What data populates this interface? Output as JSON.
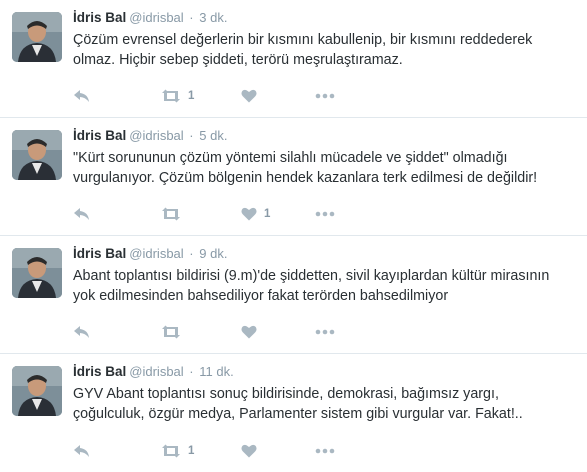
{
  "colors": {
    "name": "#292f33",
    "muted": "#8899a6",
    "icon": "#aab8c2",
    "divider": "#e1e8ed"
  },
  "icons": {
    "reply": "reply-icon",
    "retweet": "retweet-icon",
    "like": "heart-icon",
    "more": "more-icon"
  },
  "tweets": [
    {
      "name": "İdris Bal",
      "handle": "@idrisbal",
      "separator": "·",
      "time": "3 dk.",
      "text": "Çözüm evrensel değerlerin bir kısmını kabullenip, bir kısmını reddederek olmaz. Hiçbir sebep şiddeti, terörü meşrulaştıramaz.",
      "retweets": "1",
      "likes": ""
    },
    {
      "name": "İdris Bal",
      "handle": "@idrisbal",
      "separator": "·",
      "time": "5 dk.",
      "text": "\"Kürt sorununun çözüm yöntemi silahlı mücadele ve şiddet\" olmadığı vurgulanıyor. Çözüm bölgenin hendek kazanlara terk edilmesi de değildir!",
      "retweets": "",
      "likes": "1"
    },
    {
      "name": "İdris Bal",
      "handle": "@idrisbal",
      "separator": "·",
      "time": "9 dk.",
      "text": "Abant toplantısı bildirisi (9.m)'de şiddetten, sivil kayıplardan kültür mirasının yok edilmesinden bahsediliyor fakat terörden bahsedilmiyor",
      "retweets": "",
      "likes": ""
    },
    {
      "name": "İdris Bal",
      "handle": "@idrisbal",
      "separator": "·",
      "time": "11 dk.",
      "text": "GYV Abant toplantısı sonuç bildirisinde, demokrasi, bağımsız yargı, çoğulculuk, özgür medya, Parlamenter sistem gibi vurgular var. Fakat!..",
      "retweets": "1",
      "likes": ""
    }
  ]
}
